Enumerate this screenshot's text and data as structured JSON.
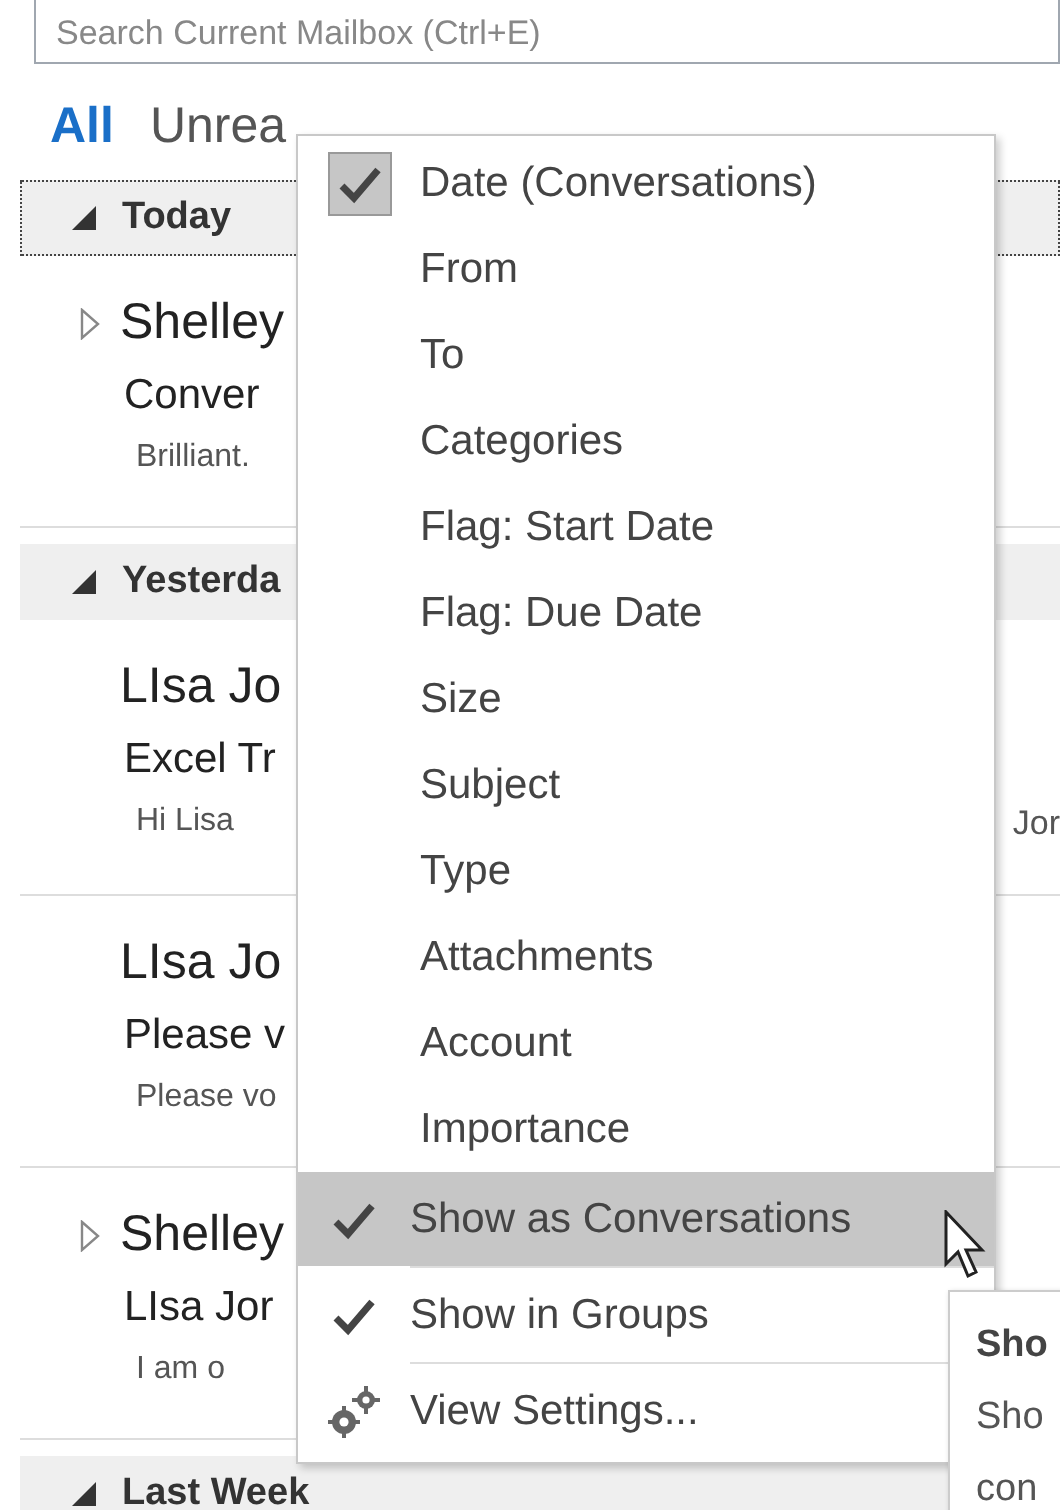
{
  "search": {
    "placeholder": "Search Current Mailbox (Ctrl+E)"
  },
  "tabs": [
    {
      "label": "All",
      "selected": true
    },
    {
      "label": "Unrea",
      "selected": false
    }
  ],
  "groups": [
    {
      "header": "Today",
      "focused": true,
      "items": [
        {
          "sender": "Shelley",
          "subject": "Conver",
          "preview": "Brilliant.",
          "expandable": true
        }
      ]
    },
    {
      "header": "Yesterda",
      "focused": false,
      "items": [
        {
          "sender": "LIsa Jo",
          "subject": "Excel Tr",
          "preview": "Hi Lisa",
          "extra": "Jor",
          "expandable": false
        },
        {
          "sender": "LIsa Jo",
          "subject": "Please v",
          "preview": "Please vo",
          "expandable": false
        },
        {
          "sender": "Shelley",
          "subject": "LIsa Jor",
          "preview": "I am o",
          "expandable": true
        }
      ]
    },
    {
      "header": "Last Week",
      "focused": false
    }
  ],
  "sort_menu": {
    "sort_options": [
      {
        "label": "Date (Conversations)",
        "checked": true
      },
      {
        "label": "From",
        "checked": false
      },
      {
        "label": "To",
        "checked": false
      },
      {
        "label": "Categories",
        "checked": false
      },
      {
        "label": "Flag: Start Date",
        "checked": false
      },
      {
        "label": "Flag: Due Date",
        "checked": false
      },
      {
        "label": "Size",
        "checked": false
      },
      {
        "label": "Subject",
        "checked": false
      },
      {
        "label": "Type",
        "checked": false
      },
      {
        "label": "Attachments",
        "checked": false
      },
      {
        "label": "Account",
        "checked": false
      },
      {
        "label": "Importance",
        "checked": false
      }
    ],
    "options": [
      {
        "label": "Show as Conversations",
        "checked": true,
        "selected": true
      },
      {
        "label": "Show in Groups",
        "checked": true,
        "selected": false
      }
    ],
    "settings": {
      "label": "View Settings..."
    }
  },
  "tooltip": {
    "title": "Sho",
    "lines": [
      "Sho",
      "con"
    ]
  }
}
